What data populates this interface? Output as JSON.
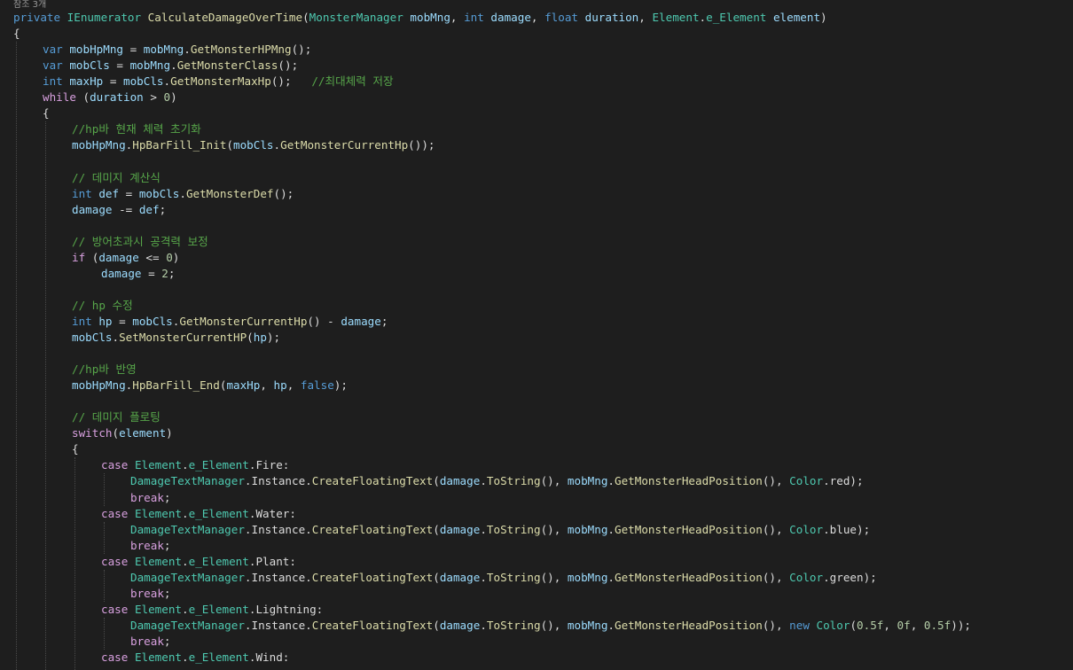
{
  "codelens": "참조 3개",
  "colors": {
    "background": "#1e1e1e",
    "keyword": "#569cd6",
    "control": "#d8a0df",
    "type": "#4ec9b0",
    "method": "#dcdcaa",
    "variable": "#9cdcfe",
    "comment": "#57a64a",
    "number": "#b5cea8",
    "plain": "#dcdcdc"
  },
  "lines": [
    {
      "indent": 0,
      "tokens": [
        [
          "kw",
          "private"
        ],
        [
          "tx",
          " "
        ],
        [
          "ty",
          "IEnumerator"
        ],
        [
          "tx",
          " "
        ],
        [
          "fn",
          "CalculateDamageOverTime"
        ],
        [
          "tx",
          "("
        ],
        [
          "ty",
          "MonsterManager"
        ],
        [
          "tx",
          " "
        ],
        [
          "vr",
          "mobMng"
        ],
        [
          "tx",
          ", "
        ],
        [
          "kw",
          "int"
        ],
        [
          "tx",
          " "
        ],
        [
          "vr",
          "damage"
        ],
        [
          "tx",
          ", "
        ],
        [
          "kw",
          "float"
        ],
        [
          "tx",
          " "
        ],
        [
          "vr",
          "duration"
        ],
        [
          "tx",
          ", "
        ],
        [
          "ty",
          "Element"
        ],
        [
          "tx",
          "."
        ],
        [
          "ty",
          "e_Element"
        ],
        [
          "tx",
          " "
        ],
        [
          "vr",
          "element"
        ],
        [
          "tx",
          ")"
        ]
      ]
    },
    {
      "indent": 0,
      "tokens": [
        [
          "tx",
          "{"
        ]
      ]
    },
    {
      "indent": 1,
      "tokens": [
        [
          "kw",
          "var"
        ],
        [
          "tx",
          " "
        ],
        [
          "vr",
          "mobHpMng"
        ],
        [
          "tx",
          " = "
        ],
        [
          "vr",
          "mobMng"
        ],
        [
          "tx",
          "."
        ],
        [
          "fn",
          "GetMonsterHPMng"
        ],
        [
          "tx",
          "();"
        ]
      ]
    },
    {
      "indent": 1,
      "tokens": [
        [
          "kw",
          "var"
        ],
        [
          "tx",
          " "
        ],
        [
          "vr",
          "mobCls"
        ],
        [
          "tx",
          " = "
        ],
        [
          "vr",
          "mobMng"
        ],
        [
          "tx",
          "."
        ],
        [
          "fn",
          "GetMonsterClass"
        ],
        [
          "tx",
          "();"
        ]
      ]
    },
    {
      "indent": 1,
      "tokens": [
        [
          "kw",
          "int"
        ],
        [
          "tx",
          " "
        ],
        [
          "vr",
          "maxHp"
        ],
        [
          "tx",
          " = "
        ],
        [
          "vr",
          "mobCls"
        ],
        [
          "tx",
          "."
        ],
        [
          "fn",
          "GetMonsterMaxHp"
        ],
        [
          "tx",
          "();   "
        ],
        [
          "cm",
          "//최대체력 저장"
        ]
      ]
    },
    {
      "indent": 1,
      "tokens": [
        [
          "ctl",
          "while"
        ],
        [
          "tx",
          " ("
        ],
        [
          "vr",
          "duration"
        ],
        [
          "tx",
          " > "
        ],
        [
          "nm",
          "0"
        ],
        [
          "tx",
          ")"
        ]
      ]
    },
    {
      "indent": 1,
      "tokens": [
        [
          "tx",
          "{"
        ]
      ]
    },
    {
      "indent": 2,
      "tokens": [
        [
          "cm",
          "//hp바 현재 체력 초기화"
        ]
      ]
    },
    {
      "indent": 2,
      "tokens": [
        [
          "vr",
          "mobHpMng"
        ],
        [
          "tx",
          "."
        ],
        [
          "fn",
          "HpBarFill_Init"
        ],
        [
          "tx",
          "("
        ],
        [
          "vr",
          "mobCls"
        ],
        [
          "tx",
          "."
        ],
        [
          "fn",
          "GetMonsterCurrentHp"
        ],
        [
          "tx",
          "());"
        ]
      ]
    },
    {
      "indent": 2,
      "tokens": []
    },
    {
      "indent": 2,
      "tokens": [
        [
          "cm",
          "// 데미지 계산식"
        ]
      ]
    },
    {
      "indent": 2,
      "tokens": [
        [
          "kw",
          "int"
        ],
        [
          "tx",
          " "
        ],
        [
          "vr",
          "def"
        ],
        [
          "tx",
          " = "
        ],
        [
          "vr",
          "mobCls"
        ],
        [
          "tx",
          "."
        ],
        [
          "fn",
          "GetMonsterDef"
        ],
        [
          "tx",
          "();"
        ]
      ]
    },
    {
      "indent": 2,
      "tokens": [
        [
          "vr",
          "damage"
        ],
        [
          "tx",
          " -= "
        ],
        [
          "vr",
          "def"
        ],
        [
          "tx",
          ";"
        ]
      ]
    },
    {
      "indent": 2,
      "tokens": []
    },
    {
      "indent": 2,
      "tokens": [
        [
          "cm",
          "// 방어초과시 공격력 보정"
        ]
      ]
    },
    {
      "indent": 2,
      "tokens": [
        [
          "ctl",
          "if"
        ],
        [
          "tx",
          " ("
        ],
        [
          "vr",
          "damage"
        ],
        [
          "tx",
          " <= "
        ],
        [
          "nm",
          "0"
        ],
        [
          "tx",
          ")"
        ]
      ]
    },
    {
      "indent": 3,
      "tokens": [
        [
          "vr",
          "damage"
        ],
        [
          "tx",
          " = "
        ],
        [
          "nm",
          "2"
        ],
        [
          "tx",
          ";"
        ]
      ]
    },
    {
      "indent": 2,
      "tokens": []
    },
    {
      "indent": 2,
      "tokens": [
        [
          "cm",
          "// hp 수정"
        ]
      ]
    },
    {
      "indent": 2,
      "tokens": [
        [
          "kw",
          "int"
        ],
        [
          "tx",
          " "
        ],
        [
          "vr",
          "hp"
        ],
        [
          "tx",
          " = "
        ],
        [
          "vr",
          "mobCls"
        ],
        [
          "tx",
          "."
        ],
        [
          "fn",
          "GetMonsterCurrentHp"
        ],
        [
          "tx",
          "() - "
        ],
        [
          "vr",
          "damage"
        ],
        [
          "tx",
          ";"
        ]
      ]
    },
    {
      "indent": 2,
      "tokens": [
        [
          "vr",
          "mobCls"
        ],
        [
          "tx",
          "."
        ],
        [
          "fn",
          "SetMonsterCurrentHP"
        ],
        [
          "tx",
          "("
        ],
        [
          "vr",
          "hp"
        ],
        [
          "tx",
          ");"
        ]
      ]
    },
    {
      "indent": 2,
      "tokens": []
    },
    {
      "indent": 2,
      "tokens": [
        [
          "cm",
          "//hp바 반영"
        ]
      ]
    },
    {
      "indent": 2,
      "tokens": [
        [
          "vr",
          "mobHpMng"
        ],
        [
          "tx",
          "."
        ],
        [
          "fn",
          "HpBarFill_End"
        ],
        [
          "tx",
          "("
        ],
        [
          "vr",
          "maxHp"
        ],
        [
          "tx",
          ", "
        ],
        [
          "vr",
          "hp"
        ],
        [
          "tx",
          ", "
        ],
        [
          "kw",
          "false"
        ],
        [
          "tx",
          ");"
        ]
      ]
    },
    {
      "indent": 2,
      "tokens": []
    },
    {
      "indent": 2,
      "tokens": [
        [
          "cm",
          "// 데미지 플로팅"
        ]
      ]
    },
    {
      "indent": 2,
      "tokens": [
        [
          "ctl",
          "switch"
        ],
        [
          "tx",
          "("
        ],
        [
          "vr",
          "element"
        ],
        [
          "tx",
          ")"
        ]
      ]
    },
    {
      "indent": 2,
      "tokens": [
        [
          "tx",
          "{"
        ]
      ]
    },
    {
      "indent": 3,
      "tokens": [
        [
          "ctl",
          "case"
        ],
        [
          "tx",
          " "
        ],
        [
          "ty",
          "Element"
        ],
        [
          "tx",
          "."
        ],
        [
          "ty",
          "e_Element"
        ],
        [
          "tx",
          ".Fire:"
        ]
      ]
    },
    {
      "indent": 4,
      "tokens": [
        [
          "ty",
          "DamageTextManager"
        ],
        [
          "tx",
          ".Instance."
        ],
        [
          "fn",
          "CreateFloatingText"
        ],
        [
          "tx",
          "("
        ],
        [
          "vr",
          "damage"
        ],
        [
          "tx",
          "."
        ],
        [
          "fn",
          "ToString"
        ],
        [
          "tx",
          "(), "
        ],
        [
          "vr",
          "mobMng"
        ],
        [
          "tx",
          "."
        ],
        [
          "fn",
          "GetMonsterHeadPosition"
        ],
        [
          "tx",
          "(), "
        ],
        [
          "ty",
          "Color"
        ],
        [
          "tx",
          ".red);"
        ]
      ]
    },
    {
      "indent": 4,
      "tokens": [
        [
          "ctl",
          "break"
        ],
        [
          "tx",
          ";"
        ]
      ]
    },
    {
      "indent": 3,
      "tokens": [
        [
          "ctl",
          "case"
        ],
        [
          "tx",
          " "
        ],
        [
          "ty",
          "Element"
        ],
        [
          "tx",
          "."
        ],
        [
          "ty",
          "e_Element"
        ],
        [
          "tx",
          ".Water:"
        ]
      ]
    },
    {
      "indent": 4,
      "tokens": [
        [
          "ty",
          "DamageTextManager"
        ],
        [
          "tx",
          ".Instance."
        ],
        [
          "fn",
          "CreateFloatingText"
        ],
        [
          "tx",
          "("
        ],
        [
          "vr",
          "damage"
        ],
        [
          "tx",
          "."
        ],
        [
          "fn",
          "ToString"
        ],
        [
          "tx",
          "(), "
        ],
        [
          "vr",
          "mobMng"
        ],
        [
          "tx",
          "."
        ],
        [
          "fn",
          "GetMonsterHeadPosition"
        ],
        [
          "tx",
          "(), "
        ],
        [
          "ty",
          "Color"
        ],
        [
          "tx",
          ".blue);"
        ]
      ]
    },
    {
      "indent": 4,
      "tokens": [
        [
          "ctl",
          "break"
        ],
        [
          "tx",
          ";"
        ]
      ]
    },
    {
      "indent": 3,
      "tokens": [
        [
          "ctl",
          "case"
        ],
        [
          "tx",
          " "
        ],
        [
          "ty",
          "Element"
        ],
        [
          "tx",
          "."
        ],
        [
          "ty",
          "e_Element"
        ],
        [
          "tx",
          ".Plant:"
        ]
      ]
    },
    {
      "indent": 4,
      "tokens": [
        [
          "ty",
          "DamageTextManager"
        ],
        [
          "tx",
          ".Instance."
        ],
        [
          "fn",
          "CreateFloatingText"
        ],
        [
          "tx",
          "("
        ],
        [
          "vr",
          "damage"
        ],
        [
          "tx",
          "."
        ],
        [
          "fn",
          "ToString"
        ],
        [
          "tx",
          "(), "
        ],
        [
          "vr",
          "mobMng"
        ],
        [
          "tx",
          "."
        ],
        [
          "fn",
          "GetMonsterHeadPosition"
        ],
        [
          "tx",
          "(), "
        ],
        [
          "ty",
          "Color"
        ],
        [
          "tx",
          ".green);"
        ]
      ]
    },
    {
      "indent": 4,
      "tokens": [
        [
          "ctl",
          "break"
        ],
        [
          "tx",
          ";"
        ]
      ]
    },
    {
      "indent": 3,
      "tokens": [
        [
          "ctl",
          "case"
        ],
        [
          "tx",
          " "
        ],
        [
          "ty",
          "Element"
        ],
        [
          "tx",
          "."
        ],
        [
          "ty",
          "e_Element"
        ],
        [
          "tx",
          ".Lightning:"
        ]
      ]
    },
    {
      "indent": 4,
      "tokens": [
        [
          "ty",
          "DamageTextManager"
        ],
        [
          "tx",
          ".Instance."
        ],
        [
          "fn",
          "CreateFloatingText"
        ],
        [
          "tx",
          "("
        ],
        [
          "vr",
          "damage"
        ],
        [
          "tx",
          "."
        ],
        [
          "fn",
          "ToString"
        ],
        [
          "tx",
          "(), "
        ],
        [
          "vr",
          "mobMng"
        ],
        [
          "tx",
          "."
        ],
        [
          "fn",
          "GetMonsterHeadPosition"
        ],
        [
          "tx",
          "(), "
        ],
        [
          "kw",
          "new"
        ],
        [
          "tx",
          " "
        ],
        [
          "ty",
          "Color"
        ],
        [
          "tx",
          "("
        ],
        [
          "nm",
          "0.5f"
        ],
        [
          "tx",
          ", "
        ],
        [
          "nm",
          "0f"
        ],
        [
          "tx",
          ", "
        ],
        [
          "nm",
          "0.5f"
        ],
        [
          "tx",
          "));"
        ]
      ]
    },
    {
      "indent": 4,
      "tokens": [
        [
          "ctl",
          "break"
        ],
        [
          "tx",
          ";"
        ]
      ]
    },
    {
      "indent": 3,
      "tokens": [
        [
          "ctl",
          "case"
        ],
        [
          "tx",
          " "
        ],
        [
          "ty",
          "Element"
        ],
        [
          "tx",
          "."
        ],
        [
          "ty",
          "e_Element"
        ],
        [
          "tx",
          ".Wind:"
        ]
      ]
    }
  ]
}
